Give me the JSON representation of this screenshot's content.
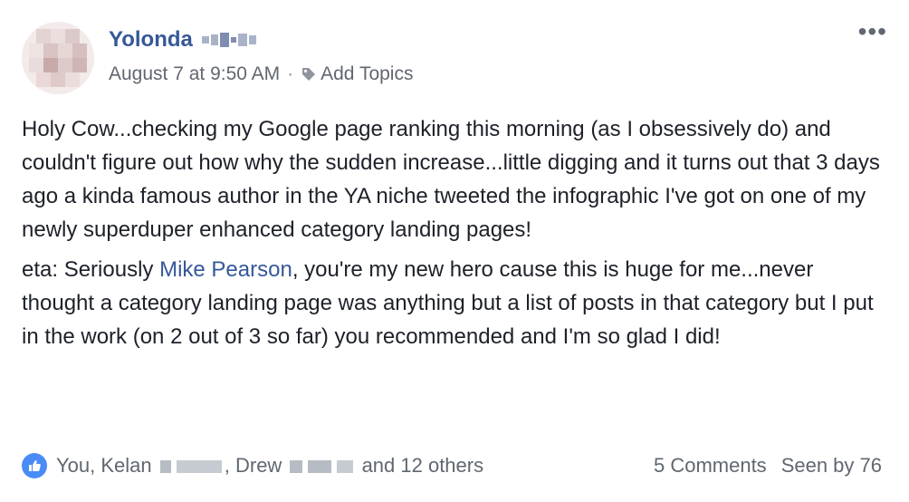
{
  "post": {
    "author": "Yolonda",
    "timestamp": "August 7 at 9:50 AM",
    "separator": "·",
    "add_topics": "Add Topics",
    "more": "•••"
  },
  "body": {
    "paragraph1": "Holy Cow...checking my Google page ranking this morning (as I obsessively do) and couldn't figure out how why the sudden increase...little digging and it turns out that 3 days ago a kinda famous author in the YA niche tweeted the infographic I've got on one of my newly superduper enhanced category landing pages!",
    "p2_before": "eta: Seriously ",
    "p2_mention": "Mike Pearson",
    "p2_after": ", you're my new hero cause this is huge for me...never thought a category landing page was anything but a list of posts in that category but I put in the work (on 2 out of 3 so far) you recommended and I'm so glad I did!"
  },
  "footer": {
    "names_part1": "You, Kelan",
    "names_part2": ", Drew",
    "names_part3": "and 12 others",
    "comments": "5 Comments",
    "seen": "Seen by 76"
  },
  "icons": {
    "more": "more-options-icon",
    "tag": "tag-icon",
    "like": "like-thumb-icon"
  },
  "colors": {
    "link": "#365899",
    "meta": "#616770",
    "like": "#4a8cf6"
  }
}
